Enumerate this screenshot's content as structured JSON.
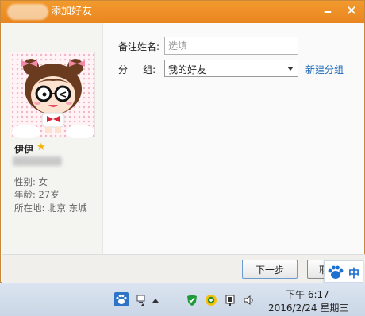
{
  "window": {
    "title": "添加好友",
    "minimize_glyph": "🗕",
    "close_glyph": "✕",
    "accent": "#ec8c22"
  },
  "profile": {
    "nickname": "伊伊",
    "badge_icon": "star-icon",
    "gender": "性别: 女",
    "age": "年龄: 27岁",
    "location": "所在地: 北京  东城"
  },
  "form": {
    "remark_label": "备注姓名:",
    "remark_value": "",
    "remark_placeholder": "选填",
    "group_label": "分      组:",
    "group_selected": "我的好友",
    "new_group_link": "新建分组"
  },
  "footer": {
    "next_button": "下一步",
    "cancel_button": "取"
  },
  "ime": {
    "label": "中",
    "icon": "paw-icon"
  },
  "taskbar": {
    "time": "下午 6:17",
    "date": "2016/2/24 星期三",
    "tray_icons": [
      "paw-icon",
      "network-icon",
      "arrow-up-icon",
      "shield-icon",
      "qq-icon",
      "flag-icon",
      "volume-icon"
    ]
  },
  "colors": {
    "link": "#1a68b8",
    "title_text": "#ffffff"
  }
}
